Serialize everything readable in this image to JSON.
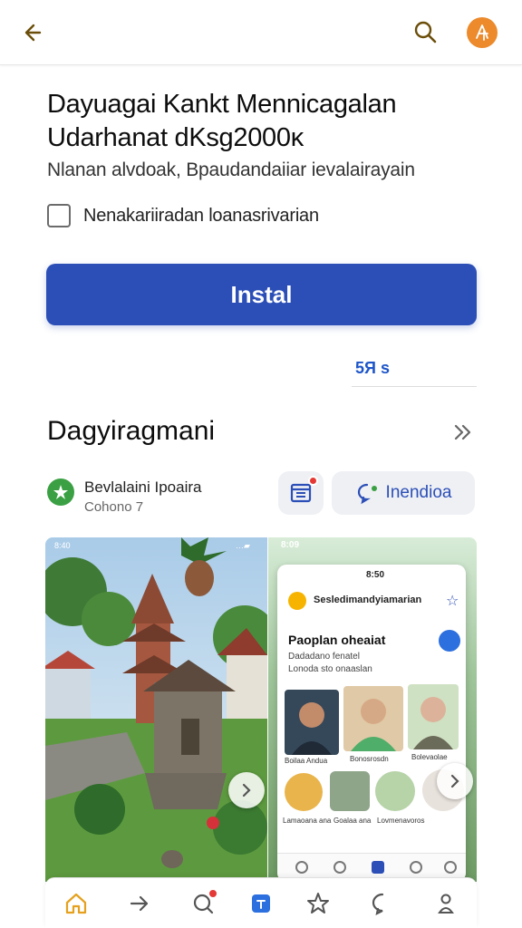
{
  "header": {
    "back_icon": "arrow-left-icon",
    "search_icon": "search-icon",
    "avatar_icon": "profile-avatar-icon",
    "avatar_color": "#ec8a2c"
  },
  "app": {
    "title_line1": "Dayuagai Kankt Mennicagalan",
    "title_line2": "Udarhanat dKsg2000ĸ",
    "subtitle": "Nlanan alvdoak, Bpaudandaiiar ievalairayain",
    "checkbox_label": "Nenakariiradan loanasrivarian",
    "checkbox_checked": false,
    "install_label": "Instal",
    "install_color": "#2c4fb7",
    "rating_text": "5Я s"
  },
  "section": {
    "title": "Dagyiragmani",
    "more_icon": "double-chevron-right-icon"
  },
  "developer": {
    "name": "Bevlalaini Ipoaira",
    "sub": "Cohono 7",
    "icon": "developer-logo-icon",
    "share_icon": "share-icon",
    "translate_icon": "chat-bubble-icon",
    "translate_label": "Inendioa"
  },
  "screenshots": {
    "shot1_status_left": "8:40",
    "shot1_status_right": "…▰",
    "shot2_status_left": "8:09",
    "phone_status": "8:50",
    "phone_header": "Sesledimandyiamarian",
    "phone_title": "Paoplan oheaiat",
    "phone_sub1": "Dadadano fenatel",
    "phone_sub2": "Lonoda sto onaaslan",
    "captions": [
      "Boilaa Andua",
      "Bonosrosdn",
      "Bolevaolae",
      "Lamaoana ana",
      "Goalaa ana",
      "Lovmenavoros"
    ]
  },
  "bottom_nav": {
    "items": [
      {
        "icon": "home-icon"
      },
      {
        "icon": "arrow-right-icon"
      },
      {
        "icon": "chat-icon"
      },
      {
        "icon": "apps-icon"
      },
      {
        "icon": "star-icon"
      },
      {
        "icon": "message-icon"
      },
      {
        "icon": "person-icon"
      }
    ],
    "active_color": "#e5a11d"
  }
}
